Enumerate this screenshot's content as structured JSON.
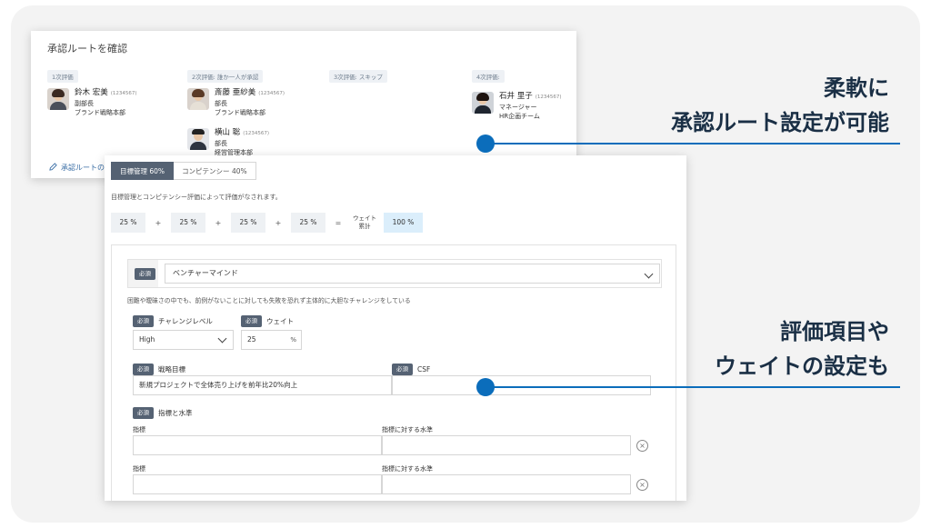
{
  "route_card": {
    "title": "承認ルートを確認",
    "edit_link": "承認ルートの",
    "steps": [
      {
        "tag": "1次評価",
        "people": [
          {
            "name": "鈴木 宏美",
            "id": "(1234567)",
            "title": "副部長",
            "dept": "ブランド戦略本部"
          }
        ]
      },
      {
        "tag": "2次評価: 誰か一人が承認",
        "people": [
          {
            "name": "斎藤 亜紗美",
            "id": "(1234567)",
            "title": "部長",
            "dept": "ブランド戦略本部"
          },
          {
            "name": "横山 聡",
            "id": "(1234567)",
            "title": "部長",
            "dept": "経営管理本部"
          }
        ]
      },
      {
        "tag": "3次評価: スキップ",
        "people": []
      },
      {
        "tag": "4次評価:",
        "people": [
          {
            "name": "石井 里子",
            "id": "(1234567)",
            "title": "マネージャー",
            "dept": "HR企画チーム"
          }
        ]
      }
    ]
  },
  "form": {
    "tabs": [
      {
        "label": "目標管理 60%"
      },
      {
        "label": "コンピテンシー 40%"
      }
    ],
    "description": "目標管理とコンピテンシー評価によって評価がなされます。",
    "weights": [
      "25 %",
      "25 %",
      "25 %",
      "25 %"
    ],
    "plus": "+",
    "equals": "=",
    "weight_total_label_1": "ウェイト",
    "weight_total_label_2": "累計",
    "weight_total": "100 %",
    "required": "必須",
    "section_select": "ベンチャーマインド",
    "section_description": "困難や曖昧さの中でも、前例がないことに対しても失敗を恐れず主体的に大胆なチャレンジをしている",
    "challenge_level_label": "チャレンジレベル",
    "challenge_level_value": "High",
    "weight_label": "ウェイト",
    "weight_value": "25",
    "percent": "%",
    "strategy_label": "戦略目標",
    "strategy_value": "新規プロジェクトで全体売り上げを前年比20%向上",
    "csf_label": "CSF",
    "indicator_section_label": "指標と水準",
    "indicator_label": "指標",
    "level_label": "指標に対する水準",
    "remove": "×"
  },
  "annotations": {
    "first": [
      "柔軟に",
      "承認ルート設定が可能"
    ],
    "second": [
      "評価項目や",
      "ウェイトの設定も"
    ]
  },
  "accent_color": "#0b6dbb"
}
